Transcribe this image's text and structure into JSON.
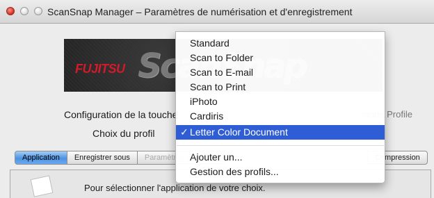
{
  "window": {
    "title": "ScanSnap Manager – Paramètres de numérisation et d'enregistrement"
  },
  "banner": {
    "fujitsu_logo": "FUJITSU",
    "scansnap_logo": "ScanSnap"
  },
  "labels": {
    "config": "Configuration de la touche",
    "config_hint": "mode Profile",
    "profile": "Choix du profil"
  },
  "profile_select": {
    "selected": "Letter Color Document"
  },
  "profile_menu": {
    "items": [
      "Standard",
      "Scan to Folder",
      "Scan to E-mail",
      "Scan to Print",
      "iPhoto",
      "Cardiris",
      "Letter Color Document"
    ],
    "selected_index": 6,
    "check_mark": "✓",
    "actions": [
      "Ajouter un...",
      "Gestion des profils..."
    ]
  },
  "tabs": {
    "items": [
      "Application",
      "Enregistrer sous",
      "Paramètres de fichier"
    ],
    "compression": "Compression"
  },
  "panel": {
    "text": "Pour sélectionner l'application de votre choix."
  },
  "colors": {
    "menu_highlight": "#2f5dd6",
    "tab_active": "#4d93e2",
    "close_button": "#d43b2d",
    "fujitsu_red": "#d11a2a"
  }
}
